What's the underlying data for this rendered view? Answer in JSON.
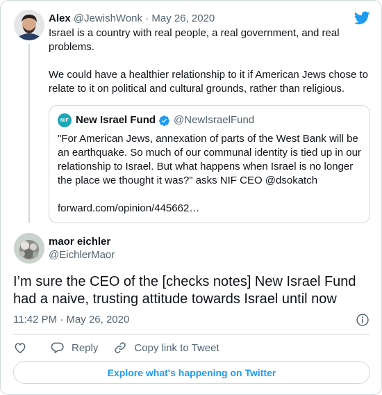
{
  "parent_tweet": {
    "author_name": "Alex",
    "author_handle": "@JewishWonk",
    "separator": "·",
    "date": "May 26, 2020",
    "paragraph1": "Israel is a country with real people, a real government, and real problems.",
    "paragraph2": "We could have a healthier relationship to it if American Jews chose to relate to it on political and cultural grounds, rather than religious."
  },
  "quoted_tweet": {
    "logo_text": "NIF",
    "author_name": "New Israel Fund",
    "author_handle": "@NewIsraelFund",
    "text": "\"For American Jews, annexation of parts of the West Bank will be an earthquake. So much of our communal identity is tied up in our relationship to Israel. But what happens when Israel is no longer the place we thought it was?\" asks NIF CEO @dsokatch",
    "link": "forward.com/opinion/445662…"
  },
  "main_tweet": {
    "author_name": "maor eichler",
    "author_handle": "@EichlerMaor",
    "text": "I’m sure the CEO of the [checks notes] New Israel Fund had a naive, trusting attitude towards Israel until now",
    "time": "11:42 PM",
    "separator": "·",
    "date": "May 26, 2020"
  },
  "actions": {
    "reply_label": "Reply",
    "copy_label": "Copy link to Tweet"
  },
  "explore_label": "Explore what's happening on Twitter",
  "colors": {
    "brand_blue": "#1d9bf0",
    "text_primary": "#0f1419",
    "text_secondary": "#536471",
    "border": "#cfd9de",
    "nif_teal": "#1aa9b7"
  },
  "icons": [
    "twitter-bird-icon",
    "verified-badge-icon",
    "info-icon",
    "heart-icon",
    "reply-icon",
    "link-icon"
  ]
}
